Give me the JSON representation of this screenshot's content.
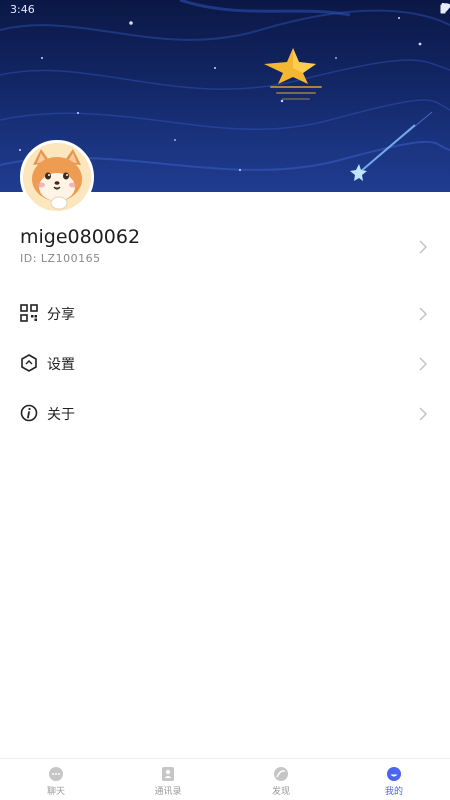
{
  "status_bar": {
    "time": "3:46"
  },
  "profile": {
    "username": "mige080062",
    "id_text": "ID: LZ100165"
  },
  "menu": [
    {
      "icon": "qr-code-icon",
      "label": "分享"
    },
    {
      "icon": "settings-hexagon-icon",
      "label": "设置"
    },
    {
      "icon": "info-icon",
      "label": "关于"
    }
  ],
  "tabbar": {
    "tabs": [
      {
        "icon": "chat-icon",
        "label": "聊天",
        "active": false
      },
      {
        "icon": "contacts-icon",
        "label": "通讯录",
        "active": false
      },
      {
        "icon": "discover-icon",
        "label": "发现",
        "active": false
      },
      {
        "icon": "profile-icon",
        "label": "我的",
        "active": true
      }
    ]
  },
  "colors": {
    "accent": "#4a66f0",
    "banner_dark": "#0b1846",
    "star": "#f5b731"
  }
}
